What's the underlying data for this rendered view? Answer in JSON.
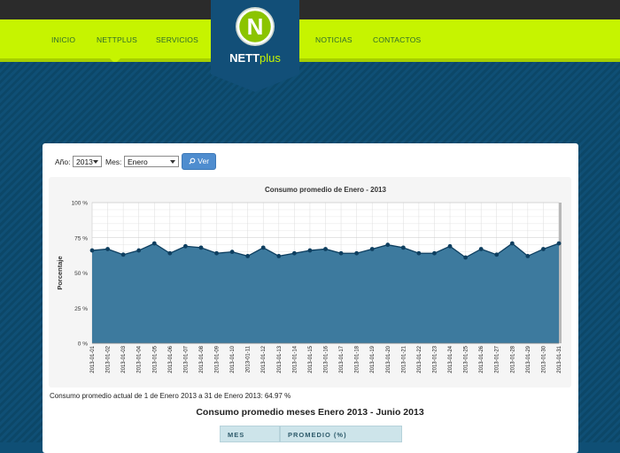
{
  "nav": {
    "items": [
      "INICIO",
      "NETTPLUS",
      "SERVICIOS",
      "NOTICIAS",
      "CONTACTOS"
    ],
    "active": "NETTPLUS"
  },
  "brand": {
    "logo_letter": "N",
    "name_part1": "NETT",
    "name_part2": "plus"
  },
  "colors": {
    "accent_green": "#c6f400",
    "navy": "#0f4f75",
    "series_fill": "#3d7a9e",
    "series_line": "#0e3f60"
  },
  "filters": {
    "year_label": "Año:",
    "year_value": "2013",
    "month_label": "Mes:",
    "month_value": "Enero",
    "view_button": "Ver",
    "view_icon": "search-icon"
  },
  "chart_data": {
    "type": "area",
    "title": "Consumo promedio de Enero - 2013",
    "ylabel": "Porcentaje",
    "xlabel": "",
    "ylim": [
      0,
      100
    ],
    "yticks": [
      0,
      25,
      50,
      75,
      100
    ],
    "ytick_labels": [
      "0 %",
      "25 %",
      "50 %",
      "75 %",
      "100 %"
    ],
    "grid": true,
    "categories": [
      "2013-01-01",
      "2013-01-02",
      "2013-01-03",
      "2013-01-04",
      "2013-01-05",
      "2013-01-06",
      "2013-01-07",
      "2013-01-08",
      "2013-01-09",
      "2013-01-10",
      "2013-01-11",
      "2013-01-12",
      "2013-01-13",
      "2013-01-14",
      "2013-01-15",
      "2013-01-16",
      "2013-01-17",
      "2013-01-18",
      "2013-01-19",
      "2013-01-20",
      "2013-01-21",
      "2013-01-22",
      "2013-01-23",
      "2013-01-24",
      "2013-01-25",
      "2013-01-26",
      "2013-01-27",
      "2013-01-28",
      "2013-01-29",
      "2013-01-30",
      "2013-01-31"
    ],
    "values": [
      66,
      67,
      63,
      66,
      71,
      64,
      69,
      68,
      64,
      65,
      62,
      68,
      62,
      64,
      66,
      67,
      64,
      64,
      67,
      70,
      68,
      64,
      64,
      69,
      61,
      67,
      63,
      71,
      62,
      67,
      71
    ]
  },
  "summary": "Consumo promedio actual de 1 de Enero 2013 a 31 de Enero 2013: 64.97 %",
  "monthly": {
    "title": "Consumo promedio meses Enero 2013 - Junio 2013",
    "columns": [
      "MES",
      "PROMEDIO (%)"
    ]
  }
}
